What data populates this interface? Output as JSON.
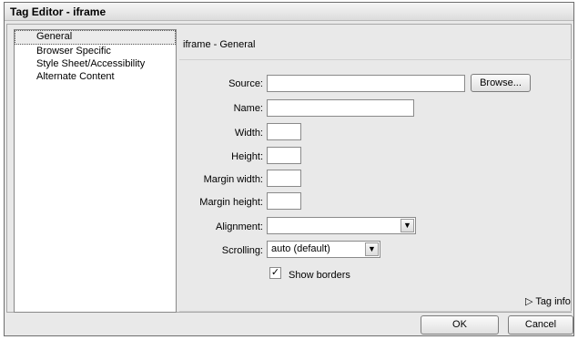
{
  "window": {
    "title": "Tag Editor - iframe"
  },
  "categories": [
    {
      "label": "General",
      "selected": true
    },
    {
      "label": "Browser Specific",
      "selected": false
    },
    {
      "label": "Style Sheet/Accessibility",
      "selected": false
    },
    {
      "label": "Alternate Content",
      "selected": false
    }
  ],
  "panel": {
    "title": "iframe - General"
  },
  "fields": {
    "source": {
      "label": "Source:",
      "value": ""
    },
    "browse_label": "Browse...",
    "name": {
      "label": "Name:",
      "value": ""
    },
    "width": {
      "label": "Width:",
      "value": ""
    },
    "height": {
      "label": "Height:",
      "value": ""
    },
    "margin_width": {
      "label": "Margin width:",
      "value": ""
    },
    "margin_height": {
      "label": "Margin height:",
      "value": ""
    },
    "alignment": {
      "label": "Alignment:",
      "value": ""
    },
    "scrolling": {
      "label": "Scrolling:",
      "value": "auto (default)"
    },
    "show_borders": {
      "label": "Show borders",
      "checked": true,
      "check_glyph": "✓"
    }
  },
  "footer": {
    "tag_info": "▷ Tag info",
    "ok_label": "OK",
    "cancel_label": "Cancel"
  },
  "icons": {
    "dropdown_arrow": "chevron-down-icon"
  }
}
